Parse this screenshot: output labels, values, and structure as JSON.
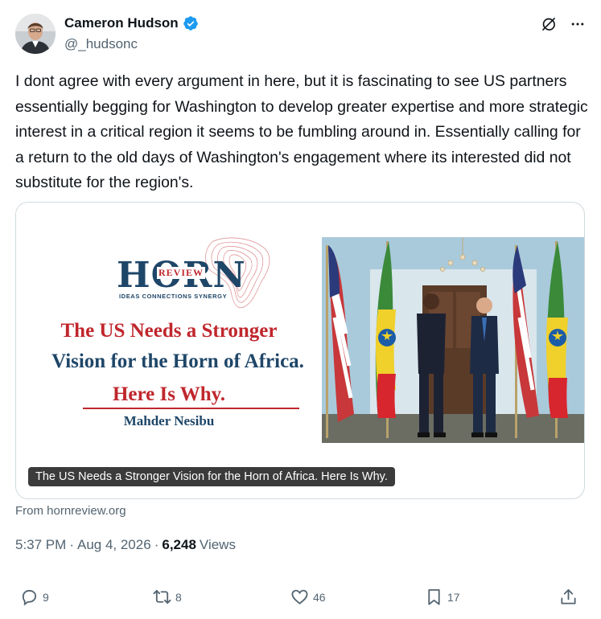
{
  "author": {
    "name": "Cameron Hudson",
    "handle": "@_hudsonc",
    "verified": true
  },
  "icons": {
    "top": [
      "grok-icon",
      "more-icon"
    ],
    "verified_color": "#1d9bf0"
  },
  "tweet": {
    "text": "I dont agree with every argument in here, but it is fascinating to see US partners essentially begging for Washington to develop greater expertise and more strategic interest in a critical region it seems to be fumbling around in. Essentially calling for a return to the old days of Washington's engagement where its interested did not substitute for the region's."
  },
  "card": {
    "logo": "HORN",
    "logo_overlay": "REVIEW",
    "logo_tagline": "IDEAS  CONNECTIONS  SYNERGY",
    "headline_line1": "The US Needs a Stronger",
    "headline_line2": "Vision for the Horn of Africa.",
    "headline_line3": "Here Is Why.",
    "author": "Mahder Nesibu",
    "caption": "The US Needs a Stronger Vision for the Horn of Africa. Here Is Why.",
    "source": "From hornreview.org"
  },
  "meta": {
    "time": "5:37 PM",
    "sep1": "·",
    "date": "Aug 4, 2026",
    "sep2": "·",
    "views_count": "6,248",
    "views_label": "Views"
  },
  "actions": {
    "replies": "9",
    "reposts": "8",
    "likes": "46",
    "bookmarks": "17"
  },
  "colors": {
    "text": "#0f1419",
    "secondary": "#536471",
    "card_red": "#c0272d",
    "card_navy": "#1e4668"
  }
}
